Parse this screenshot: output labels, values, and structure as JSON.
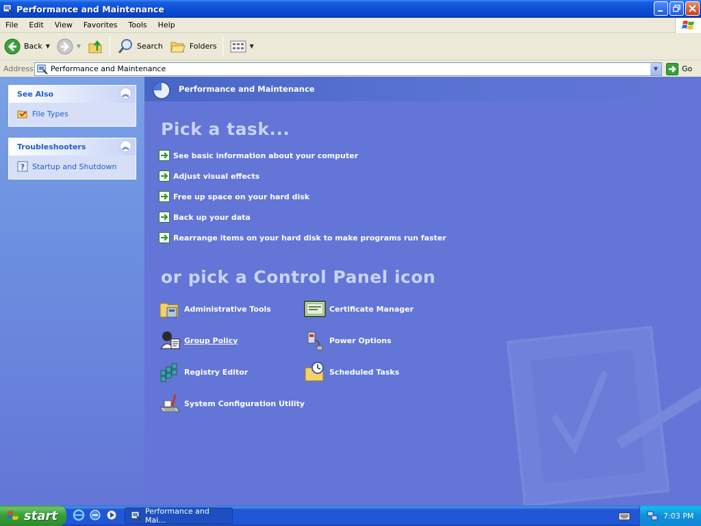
{
  "window": {
    "title": "Performance and Maintenance"
  },
  "menu": [
    "File",
    "Edit",
    "View",
    "Favorites",
    "Tools",
    "Help"
  ],
  "toolbar": {
    "back_label": "Back",
    "search_label": "Search",
    "folders_label": "Folders"
  },
  "address": {
    "label": "Address",
    "value": "Performance and Maintenance",
    "go_label": "Go"
  },
  "see_also": {
    "title": "See Also",
    "items": [
      {
        "label": "File Types",
        "icon": "file-types-icon"
      }
    ]
  },
  "troubleshooters": {
    "title": "Troubleshooters",
    "items": [
      {
        "label": "Startup and Shutdown",
        "icon": "help-icon"
      }
    ]
  },
  "main": {
    "header_title": "Performance and Maintenance",
    "pick_task_title": "Pick a task...",
    "tasks": [
      "See basic information about your computer",
      "Adjust visual effects",
      "Free up space on your hard disk",
      "Back up your data",
      "Rearrange items on your hard disk to make programs run faster"
    ],
    "pick_icon_title": "or pick a Control Panel icon",
    "icons": [
      {
        "label": "Administrative Tools",
        "icon": "administrative-tools-icon"
      },
      {
        "label": "Certificate Manager",
        "icon": "certificate-icon"
      },
      {
        "label": "Group Policy",
        "icon": "group-policy-icon"
      },
      {
        "label": "Power Options",
        "icon": "power-options-icon"
      },
      {
        "label": "Registry Editor",
        "icon": "registry-editor-icon"
      },
      {
        "label": "Scheduled Tasks",
        "icon": "scheduled-tasks-icon"
      },
      {
        "label": "System Configuration Utility",
        "icon": "system-config-icon"
      }
    ]
  },
  "taskbar": {
    "start_label": "start",
    "task_label": "Performance and Mai...",
    "clock": "7:03 PM"
  },
  "colors": {
    "main_bg": "#6375d6",
    "sidebar_link": "#215dc6",
    "title_bar": "#0a4fd5",
    "start_green": "#37a237"
  }
}
